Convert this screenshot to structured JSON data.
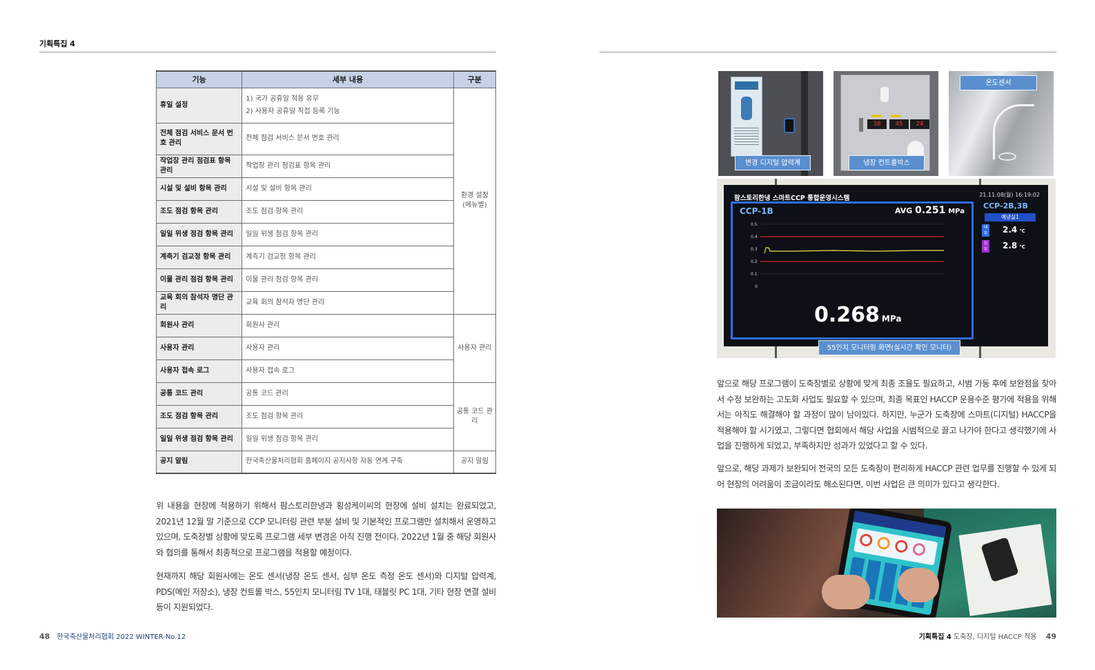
{
  "header": {
    "section_label": "기획특집 4"
  },
  "table": {
    "headers": [
      "기능",
      "세부 내용",
      "구분"
    ],
    "rows": [
      {
        "func": "휴일 설정",
        "detail": [
          "1) 국가 공휴일 적용 유무",
          "2) 사용자 공휴일 직접 등록 기능"
        ]
      },
      {
        "func": "전체 점검 서비스 문서 번호 관리",
        "detail": [
          "전체 점검 서비스 문서 번호 관리"
        ]
      },
      {
        "func": "작업장 관리 점검표 항목 관리",
        "detail": [
          "작업장 관리 점검표 항목 관리"
        ]
      },
      {
        "func": "시설 및 설비 항목 관리",
        "detail": [
          "시설 및 설비 항목 관리"
        ]
      },
      {
        "func": "조도 점검 항목 관리",
        "detail": [
          "조도 점검 항목 관리"
        ]
      },
      {
        "func": "일일 위생 점검 항목 관리",
        "detail": [
          "일일 위생 점검 항목 관리"
        ]
      },
      {
        "func": "계측기 검교정 항목 관리",
        "detail": [
          "계측기 검교정 항목 관리"
        ]
      },
      {
        "func": "이물 관리 점검 항목 관리",
        "detail": [
          "이물 관리 점검 항목 관리"
        ]
      },
      {
        "func": "교육 회의 참석자 명단 관리",
        "detail": [
          "교육 회의 참석자 명단 관리"
        ]
      },
      {
        "func": "회원사 관리",
        "detail": [
          "회원사 관리"
        ]
      },
      {
        "func": "사용자 관리",
        "detail": [
          "사용자 관리"
        ]
      },
      {
        "func": "사용자 접속 로그",
        "detail": [
          "사용자 접속 로그"
        ]
      },
      {
        "func": "공통 코드 관리",
        "detail": [
          "공통 코드 관리"
        ]
      },
      {
        "func": "조도 점검 항목 관리",
        "detail": [
          "조도 점검 항목 관리"
        ]
      },
      {
        "func": "일일 위생 점검 항목 관리",
        "detail": [
          "일일 위생 점검 항목 관리"
        ]
      },
      {
        "func": "공지 알림",
        "detail": [
          "한국축산물처리협회 홈페이지 공지사항 자동 연계 구축"
        ]
      }
    ],
    "categories": [
      {
        "label": "환경 설정 (메뉴별)",
        "start": 0,
        "span": 9
      },
      {
        "label": "사용자 관리",
        "start": 9,
        "span": 3
      },
      {
        "label": "공통 코드 관리",
        "start": 12,
        "span": 3
      },
      {
        "label": "공지 알림",
        "start": 15,
        "span": 1
      }
    ]
  },
  "body_left": [
    "위 내용을 현장에 적용하기 위해서 팜스토리한냉과 횡성케이씨의 현장에 설비 설치는 완료되었고, 2021년 12월 말 기준으로 CCP 모니터링 관련 부분 설비 및 기본적인 프로그램만 설치해서 운영하고 있으며, 도축장별 상황에 맞도록 프로그램 세부 변경은 아직 진행 전이다. 2022년 1월 중 해당 회원사와 협의를 통해서 최종적으로 프로그램을 적용할 예정이다.",
    "현재까지 해당 회원사에는 온도 센서(냉장 온도 센서, 심부 온도 측정 온도 센서)와 디지털 압력계, PDS(메인 저장소), 냉장 컨트롤 박스, 55인치 모니터링 TV 1대, 태블릿 PC 1대, 기타 현장 연결 설비 등이 지원되었다."
  ],
  "body_right": [
    "앞으로 해당 프로그램이 도축장별로 상황에 맞게 최종 조율도 필요하고, 시범 가동 후에 보완점을 찾아서 수정 보완하는 고도화 사업도 필요할 수 있으며, 최종 목표인 HACCP 운용수준 평가에 적용을 위해서는 아직도 해결해야 할 과정이 많이 남아있다. 하지만, 누군가 도축장에 스마트(디지털) HACCP을 적용해야 할 시기였고, 그렇다면 협회에서 해당 사업을 시범적으로 끌고 나가야 한다고 생각했기에 사업을 진행하게 되었고, 부족하지만 성과가 있었다고 할 수 있다.",
    "앞으로, 해당 과제가 보완되어 전국의 모든 도축장이 편리하게 HACCP 관련 업무를 진행할 수 있게 되어 현장의 어려움이 조금이라도 해소된다면, 이번 사업은 큰 의미가 있다고 생각한다."
  ],
  "photos": {
    "captions": [
      "변경 디지털 압력계",
      "냉장 컨트롤박스",
      "온도센서",
      "55인치 모니터링 화면(실시간 확인 모니터)"
    ],
    "fridge_displays": [
      "38",
      "45",
      "24"
    ],
    "monitor": {
      "title": "팜스토리한냉 스마트CCP 통합운영시스템",
      "datetime": "21.11.08(월) 16:19:02",
      "ccp_left": "CCP-1B",
      "avg_label": "AVG",
      "avg_value": "0.251",
      "avg_unit": "MPa",
      "big_value": "0.268",
      "big_unit": "MPa",
      "y_ticks": [
        "0.5",
        "0.4",
        "0.3",
        "0.2",
        "0.1",
        "0"
      ],
      "ccp_right": "CCP-2B,3B",
      "room": "예냉실1",
      "readings": [
        {
          "tag": "내부",
          "value": "2.4",
          "unit": "℃",
          "color": "#2d6ee8"
        },
        {
          "tag": "심부",
          "value": "2.8",
          "unit": "℃",
          "color": "#9b2fd1"
        }
      ]
    }
  },
  "footer_left": {
    "page": "48",
    "text": "한국축산물처리협회 2022 WINTER-No.12"
  },
  "footer_right": {
    "section": "기획특집 4",
    "text": "도축장, 디지털 HACCP 적용",
    "page": "49"
  }
}
